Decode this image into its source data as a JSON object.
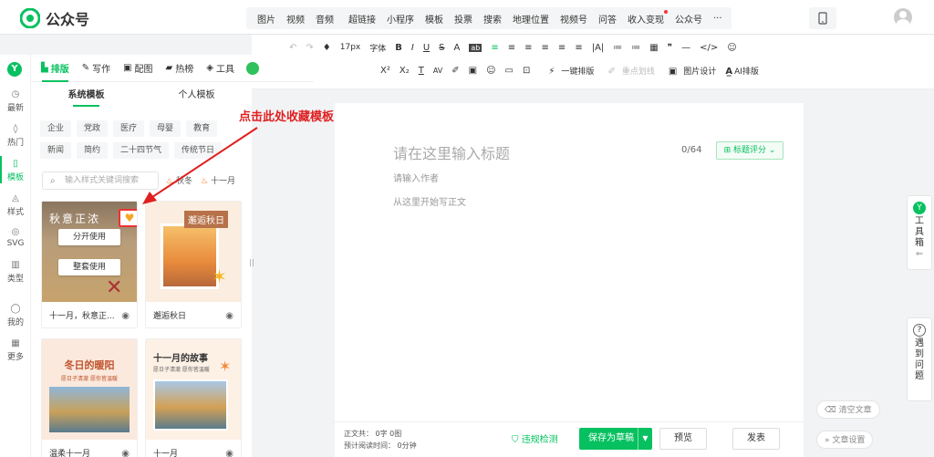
{
  "topbar": {
    "app_name": "公众号",
    "menu1": [
      "图片",
      "视频",
      "音频"
    ],
    "menu2": [
      "超链接",
      "小程序",
      "模板",
      "投票",
      "搜索",
      "地理位置",
      "视频号",
      "问答",
      "收入变现",
      "公众号",
      "···"
    ]
  },
  "leftbar": {
    "items": [
      {
        "label": "最新",
        "icon": "clock-icon",
        "glyph": "◷"
      },
      {
        "label": "热门",
        "icon": "flame-icon",
        "glyph": "◊"
      },
      {
        "label": "模板",
        "icon": "template-icon",
        "glyph": "▯"
      },
      {
        "label": "样式",
        "icon": "style-icon",
        "glyph": "◬"
      },
      {
        "label": "SVG",
        "icon": "svg-icon",
        "glyph": "◎"
      },
      {
        "label": "类型",
        "icon": "type-icon",
        "glyph": "▥"
      },
      {
        "label": "我的",
        "icon": "user-icon",
        "glyph": "◯"
      },
      {
        "label": "更多",
        "icon": "grid-icon",
        "glyph": "▦"
      }
    ]
  },
  "tabs": [
    {
      "label": "排版",
      "icon": "▙"
    },
    {
      "label": "写作",
      "icon": "✎"
    },
    {
      "label": "配图",
      "icon": "▣"
    },
    {
      "label": "热榜",
      "icon": "▰"
    },
    {
      "label": "工具",
      "icon": "◈"
    }
  ],
  "panel": {
    "subtabs": [
      "系统模板",
      "个人模板"
    ],
    "categories": [
      "企业",
      "党政",
      "医疗",
      "母婴",
      "教育",
      "新闻",
      "简约",
      "二十四节气",
      "传统节日"
    ],
    "search_placeholder": "输入样式关键词搜索",
    "hot1": "秋冬",
    "hot2": "十一月",
    "cards": [
      {
        "label": "十一月，秋意正...",
        "thumb_text": "秋意正浓"
      },
      {
        "label": "邂逅秋日",
        "thumb_text": "邂逅秋日"
      },
      {
        "label": "温柔十一月",
        "thumb_text": "冬日的暖阳",
        "thumb_sub": "愿日子清澈 愿你皆温暖"
      },
      {
        "label": "十一月",
        "thumb_text": "十一月的故事",
        "thumb_sub": "愿日子清澈 愿你皆温暖"
      }
    ],
    "use_btn": "分开使用",
    "full_btn": "整套使用"
  },
  "toolbar": {
    "row1": [
      "↶",
      "↷",
      "♦",
      "17px",
      "字体",
      "B",
      "I",
      "U",
      "S",
      "A",
      "ab",
      "≡",
      "≡",
      "≡",
      "≡",
      "≡",
      "≡",
      "|A|",
      "≔",
      "≔",
      "▦",
      "❞",
      "—",
      "</>",
      "☺"
    ],
    "row2": [
      "X²",
      "X₂",
      "T",
      "AV",
      "✐",
      "▣",
      "☺",
      "▭",
      "⊡"
    ],
    "oneclick": "一键排版",
    "underline": "重点划线",
    "imagedesign": "图片设计",
    "ai": "AI排版"
  },
  "editor": {
    "title_placeholder": "请在这里输入标题",
    "count": "0/64",
    "score": "标题评分",
    "author_placeholder": "请输入作者",
    "body_placeholder": "从这里开始写正文"
  },
  "bottom": {
    "stat1": "正文共： 0字 0图",
    "stat2": "预计阅读时间： 0分钟",
    "check": "违规检测",
    "save": "保存为草稿",
    "preview": "预览",
    "publish": "发表"
  },
  "right": {
    "toolbox": "工具箱",
    "problem": "遇到问题",
    "clear": "清空文章",
    "settings": "文章设置"
  },
  "annotation": "点击此处收藏模板",
  "colors": {
    "accent": "#07c160",
    "annotation": "#e02020"
  }
}
